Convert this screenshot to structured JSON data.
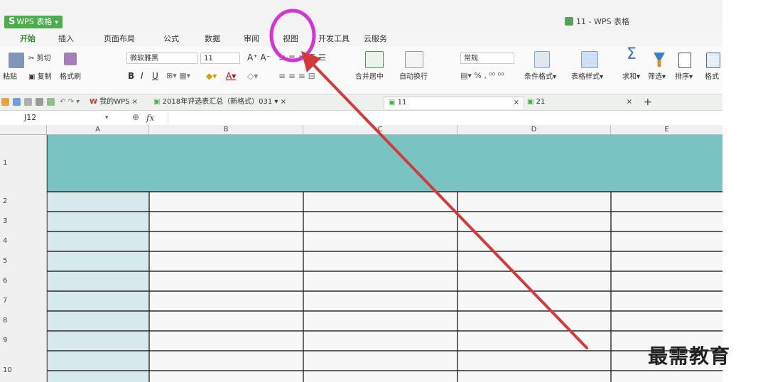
{
  "app": {
    "name": "WPS 表格",
    "logo": "S",
    "window_title": "11 - WPS 表格"
  },
  "menu": {
    "tabs": [
      "开始",
      "插入",
      "页面布局",
      "公式",
      "数据",
      "审阅",
      "视图",
      "开发工具",
      "云服务"
    ],
    "active": "开始",
    "highlighted": "视图"
  },
  "ribbon": {
    "paste": "粘贴",
    "cut": "剪切",
    "copy": "复制",
    "format_painter": "格式刷",
    "font_name": "微软雅黑",
    "font_size": "11",
    "merge_center": "合并居中",
    "wrap_text": "自动换行",
    "number_format": "常规",
    "percent": "%",
    "cond_format": "条件格式",
    "table_style": "表格样式",
    "sum": "求和",
    "filter": "筛选",
    "sort": "排序",
    "format": "格式"
  },
  "doc_tabs": [
    {
      "label": "我的WPS",
      "active": false
    },
    {
      "label": "2018年评选表汇总（新格式）031",
      "active": false
    },
    {
      "label": "11",
      "active": true
    },
    {
      "label": "21",
      "active": false
    }
  ],
  "formula_bar": {
    "cell_ref": "J12",
    "fx": "fx"
  },
  "columns": [
    "A",
    "B",
    "C",
    "D",
    "E"
  ],
  "rows": [
    "1",
    "2",
    "3",
    "4",
    "5",
    "6",
    "7",
    "8",
    "9",
    "10"
  ],
  "watermark": "最需教育",
  "colors": {
    "accent_green": "#4cad4c",
    "header_teal": "#79c3c3",
    "colA_fill": "#d6eaee",
    "annotation_circle": "#d633d6",
    "annotation_arrow": "#d33a3a"
  }
}
